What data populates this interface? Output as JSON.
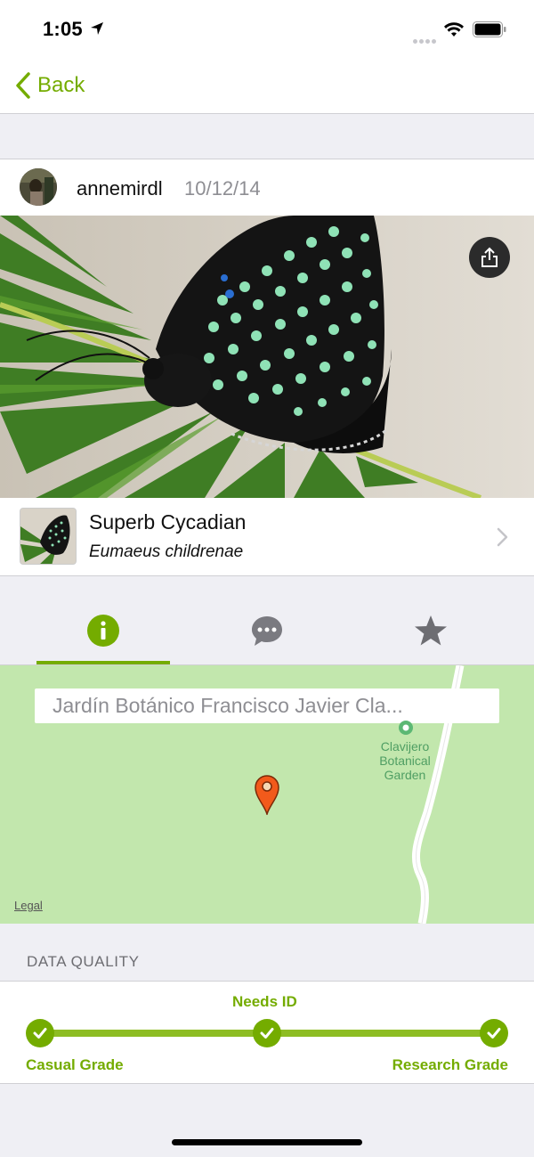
{
  "status_bar": {
    "time": "1:05",
    "icons": [
      "location-arrow-icon",
      "signal-dots-icon",
      "wifi-icon",
      "battery-icon"
    ]
  },
  "nav": {
    "back_label": "Back",
    "accent_color": "#74ac00"
  },
  "observation": {
    "username": "annemirdl",
    "date": "10/12/14"
  },
  "photo": {
    "share_icon": "share-icon"
  },
  "species": {
    "common_name": "Superb Cycadian",
    "scientific_name": "Eumaeus childrenae"
  },
  "tabs": [
    {
      "name": "info",
      "icon": "info-icon",
      "active": true
    },
    {
      "name": "activity",
      "icon": "chat-bubble-icon",
      "active": false
    },
    {
      "name": "favorites",
      "icon": "star-icon",
      "active": false
    }
  ],
  "map": {
    "location_text": "Jardín Botánico Francisco Javier Cla...",
    "poi_line1": "Clavijero",
    "poi_line2": "Botanical",
    "poi_line3": "Garden",
    "legal": "Legal",
    "background_color": "#c2e7ad",
    "pin_color": "#f25a1b"
  },
  "data_quality": {
    "header": "DATA QUALITY",
    "levels": [
      "Casual Grade",
      "Needs ID",
      "Research Grade"
    ],
    "progress": 1.0
  }
}
